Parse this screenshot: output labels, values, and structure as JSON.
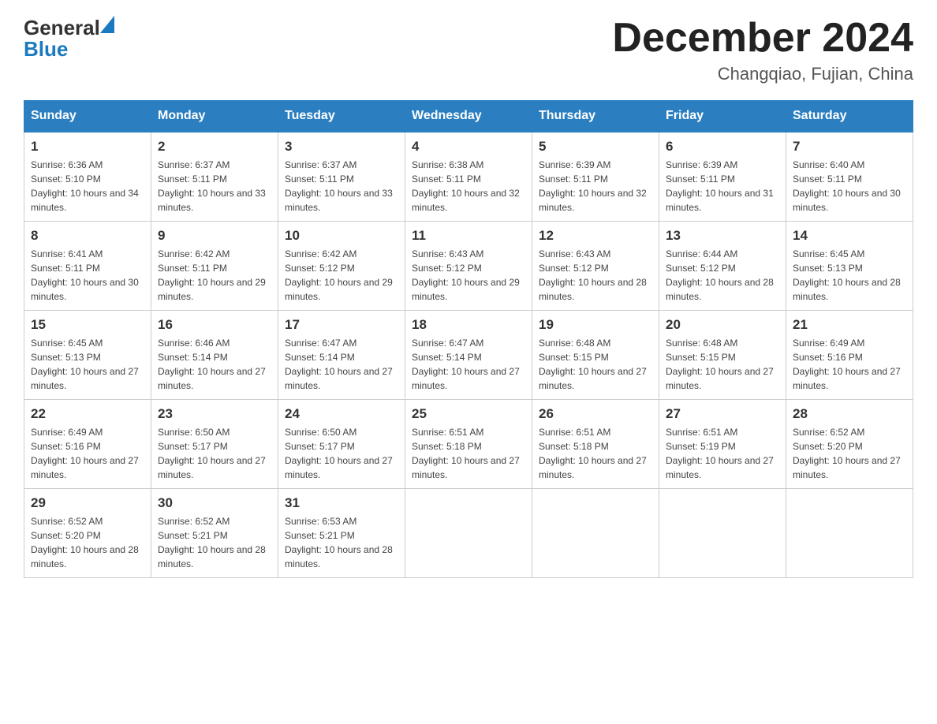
{
  "header": {
    "logo_general": "General",
    "logo_blue": "Blue",
    "month_title": "December 2024",
    "subtitle": "Changqiao, Fujian, China"
  },
  "weekdays": [
    "Sunday",
    "Monday",
    "Tuesday",
    "Wednesday",
    "Thursday",
    "Friday",
    "Saturday"
  ],
  "rows": [
    [
      {
        "day": "1",
        "sunrise": "6:36 AM",
        "sunset": "5:10 PM",
        "daylight": "10 hours and 34 minutes."
      },
      {
        "day": "2",
        "sunrise": "6:37 AM",
        "sunset": "5:11 PM",
        "daylight": "10 hours and 33 minutes."
      },
      {
        "day": "3",
        "sunrise": "6:37 AM",
        "sunset": "5:11 PM",
        "daylight": "10 hours and 33 minutes."
      },
      {
        "day": "4",
        "sunrise": "6:38 AM",
        "sunset": "5:11 PM",
        "daylight": "10 hours and 32 minutes."
      },
      {
        "day": "5",
        "sunrise": "6:39 AM",
        "sunset": "5:11 PM",
        "daylight": "10 hours and 32 minutes."
      },
      {
        "day": "6",
        "sunrise": "6:39 AM",
        "sunset": "5:11 PM",
        "daylight": "10 hours and 31 minutes."
      },
      {
        "day": "7",
        "sunrise": "6:40 AM",
        "sunset": "5:11 PM",
        "daylight": "10 hours and 30 minutes."
      }
    ],
    [
      {
        "day": "8",
        "sunrise": "6:41 AM",
        "sunset": "5:11 PM",
        "daylight": "10 hours and 30 minutes."
      },
      {
        "day": "9",
        "sunrise": "6:42 AM",
        "sunset": "5:11 PM",
        "daylight": "10 hours and 29 minutes."
      },
      {
        "day": "10",
        "sunrise": "6:42 AM",
        "sunset": "5:12 PM",
        "daylight": "10 hours and 29 minutes."
      },
      {
        "day": "11",
        "sunrise": "6:43 AM",
        "sunset": "5:12 PM",
        "daylight": "10 hours and 29 minutes."
      },
      {
        "day": "12",
        "sunrise": "6:43 AM",
        "sunset": "5:12 PM",
        "daylight": "10 hours and 28 minutes."
      },
      {
        "day": "13",
        "sunrise": "6:44 AM",
        "sunset": "5:12 PM",
        "daylight": "10 hours and 28 minutes."
      },
      {
        "day": "14",
        "sunrise": "6:45 AM",
        "sunset": "5:13 PM",
        "daylight": "10 hours and 28 minutes."
      }
    ],
    [
      {
        "day": "15",
        "sunrise": "6:45 AM",
        "sunset": "5:13 PM",
        "daylight": "10 hours and 27 minutes."
      },
      {
        "day": "16",
        "sunrise": "6:46 AM",
        "sunset": "5:14 PM",
        "daylight": "10 hours and 27 minutes."
      },
      {
        "day": "17",
        "sunrise": "6:47 AM",
        "sunset": "5:14 PM",
        "daylight": "10 hours and 27 minutes."
      },
      {
        "day": "18",
        "sunrise": "6:47 AM",
        "sunset": "5:14 PM",
        "daylight": "10 hours and 27 minutes."
      },
      {
        "day": "19",
        "sunrise": "6:48 AM",
        "sunset": "5:15 PM",
        "daylight": "10 hours and 27 minutes."
      },
      {
        "day": "20",
        "sunrise": "6:48 AM",
        "sunset": "5:15 PM",
        "daylight": "10 hours and 27 minutes."
      },
      {
        "day": "21",
        "sunrise": "6:49 AM",
        "sunset": "5:16 PM",
        "daylight": "10 hours and 27 minutes."
      }
    ],
    [
      {
        "day": "22",
        "sunrise": "6:49 AM",
        "sunset": "5:16 PM",
        "daylight": "10 hours and 27 minutes."
      },
      {
        "day": "23",
        "sunrise": "6:50 AM",
        "sunset": "5:17 PM",
        "daylight": "10 hours and 27 minutes."
      },
      {
        "day": "24",
        "sunrise": "6:50 AM",
        "sunset": "5:17 PM",
        "daylight": "10 hours and 27 minutes."
      },
      {
        "day": "25",
        "sunrise": "6:51 AM",
        "sunset": "5:18 PM",
        "daylight": "10 hours and 27 minutes."
      },
      {
        "day": "26",
        "sunrise": "6:51 AM",
        "sunset": "5:18 PM",
        "daylight": "10 hours and 27 minutes."
      },
      {
        "day": "27",
        "sunrise": "6:51 AM",
        "sunset": "5:19 PM",
        "daylight": "10 hours and 27 minutes."
      },
      {
        "day": "28",
        "sunrise": "6:52 AM",
        "sunset": "5:20 PM",
        "daylight": "10 hours and 27 minutes."
      }
    ],
    [
      {
        "day": "29",
        "sunrise": "6:52 AM",
        "sunset": "5:20 PM",
        "daylight": "10 hours and 28 minutes."
      },
      {
        "day": "30",
        "sunrise": "6:52 AM",
        "sunset": "5:21 PM",
        "daylight": "10 hours and 28 minutes."
      },
      {
        "day": "31",
        "sunrise": "6:53 AM",
        "sunset": "5:21 PM",
        "daylight": "10 hours and 28 minutes."
      },
      null,
      null,
      null,
      null
    ]
  ],
  "labels": {
    "sunrise_prefix": "Sunrise: ",
    "sunset_prefix": "Sunset: ",
    "daylight_prefix": "Daylight: "
  }
}
